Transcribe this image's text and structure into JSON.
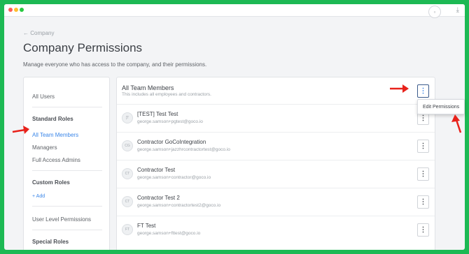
{
  "back_link": "← Company",
  "page_title": "Company Permissions",
  "subtitle": "Manage everyone who has access to the company, and their permissions.",
  "sidebar": {
    "all_users": "All Users",
    "standard_roles_heading": "Standard Roles",
    "standard_roles": [
      "All Team Members",
      "Managers",
      "Full Access Admins"
    ],
    "custom_roles_heading": "Custom Roles",
    "add_label": "+ Add",
    "user_level": "User Level Permissions",
    "special_roles_heading": "Special Roles"
  },
  "main": {
    "title": "All Team Members",
    "subtitle": "This includes all employees and contractors.",
    "members": [
      {
        "initials": "[T",
        "name": "[TEST] Test Test",
        "email": "george.samson+pgtest@goco.io"
      },
      {
        "initials": "CG",
        "name": "Contractor GoCoIntegration",
        "email": "george.samson+jazzhrcontractortest@goco.io"
      },
      {
        "initials": "CT",
        "name": "Contractor Test",
        "email": "george.samson+contractor@goco.io"
      },
      {
        "initials": "CT",
        "name": "Contractor Test 2",
        "email": "george.samson+contractortest2@goco.io"
      },
      {
        "initials": "FT",
        "name": "FT Test",
        "email": "george.samson+fttest@goco.io"
      }
    ]
  },
  "dropdown": {
    "edit_permissions": "Edit Permissions"
  },
  "colors": {
    "background": "#1db954",
    "accent": "#3a86e8",
    "arrow": "#e8221b"
  }
}
